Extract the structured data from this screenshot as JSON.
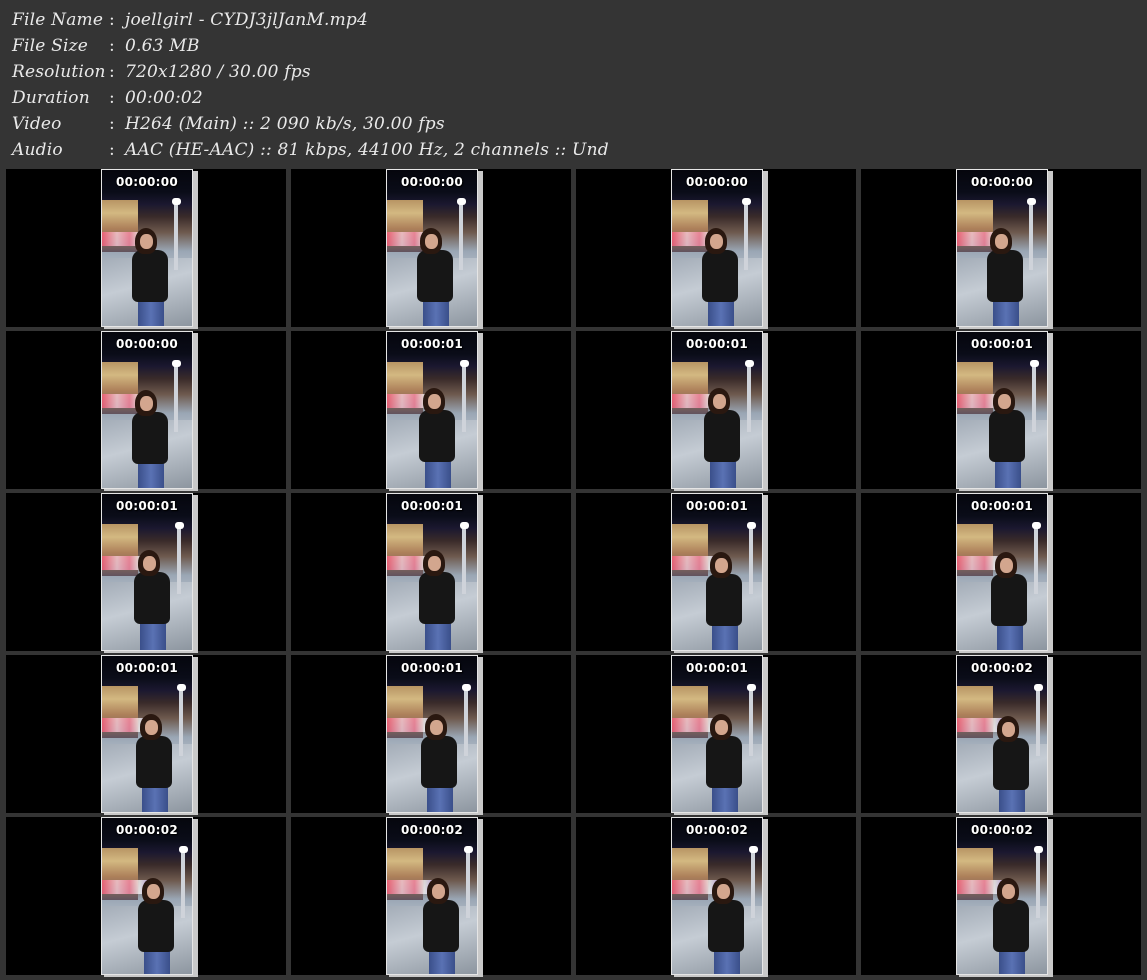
{
  "info": [
    {
      "label": "File Name",
      "value": "joellgirl - CYDJ3jlJanM.mp4"
    },
    {
      "label": "File Size",
      "value": "0.63 MB"
    },
    {
      "label": "Resolution",
      "value": "720x1280 / 30.00 fps"
    },
    {
      "label": "Duration",
      "value": "00:00:02"
    },
    {
      "label": "Video",
      "value": "H264 (Main) :: 2 090 kb/s, 30.00 fps"
    },
    {
      "label": "Audio",
      "value": "AAC (HE-AAC) :: 81 kbps, 44100 Hz, 2 channels :: Und"
    }
  ],
  "separator": ":",
  "thumbnails": [
    "00:00:00",
    "00:00:00",
    "00:00:00",
    "00:00:00",
    "00:00:00",
    "00:00:01",
    "00:00:01",
    "00:00:01",
    "00:00:01",
    "00:00:01",
    "00:00:01",
    "00:00:01",
    "00:00:01",
    "00:00:01",
    "00:00:01",
    "00:00:02",
    "00:00:02",
    "00:00:02",
    "00:00:02",
    "00:00:02"
  ]
}
